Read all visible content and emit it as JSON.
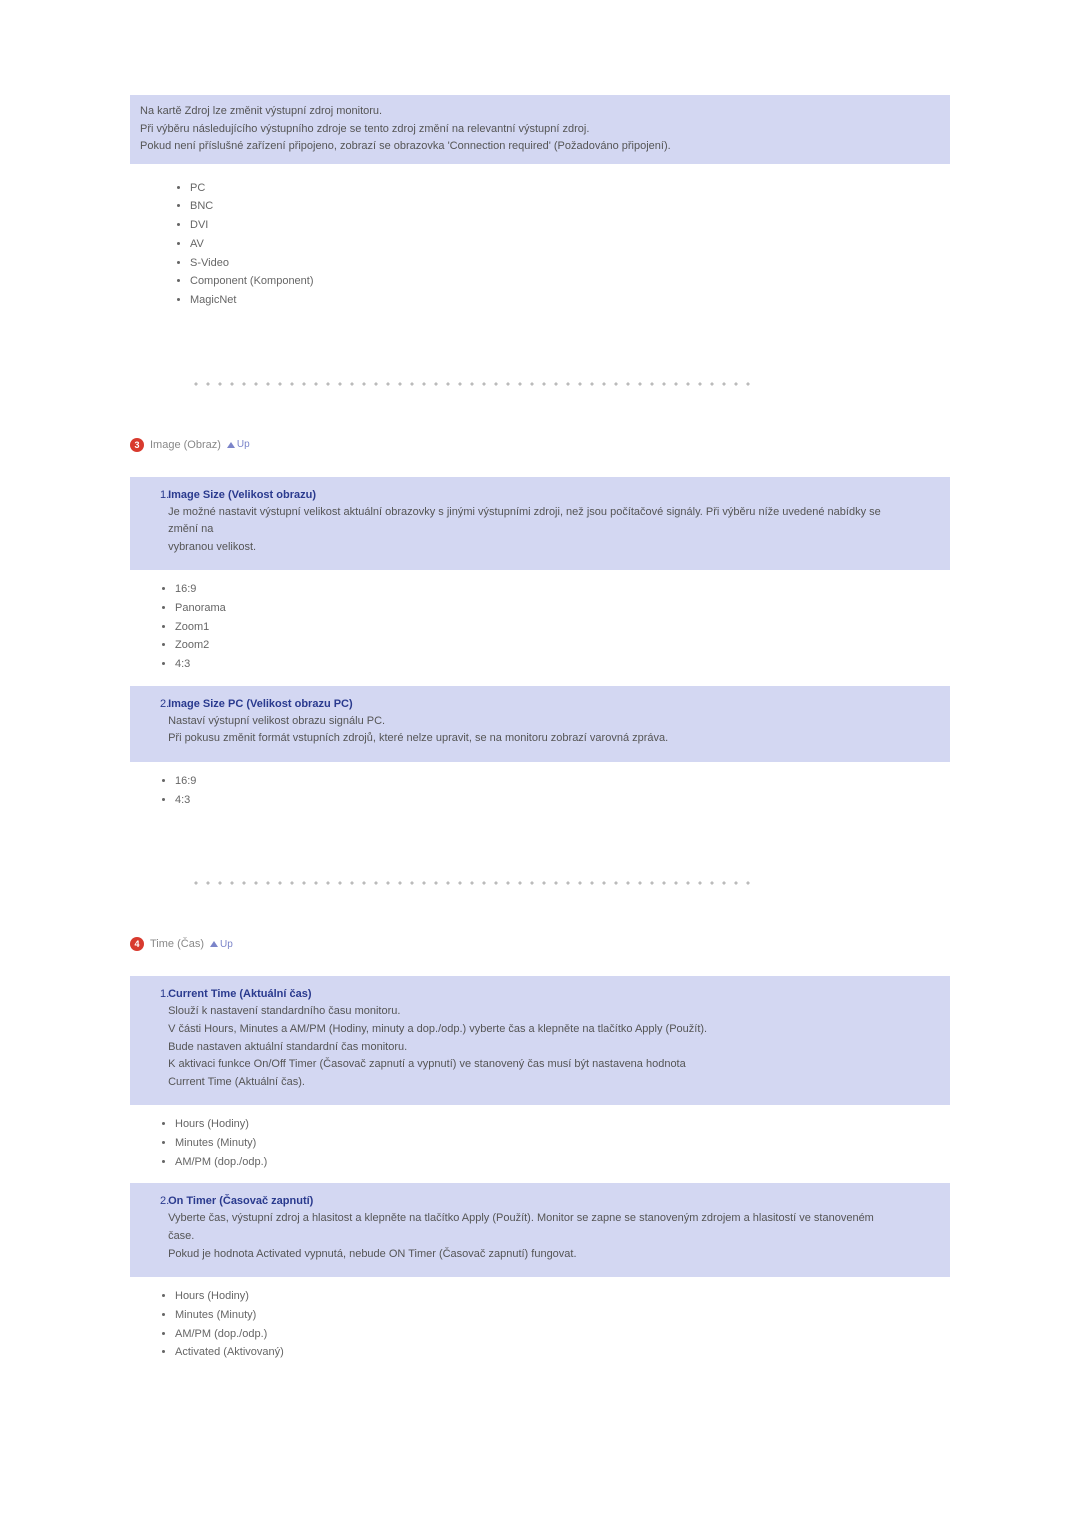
{
  "intro": {
    "line1": "Na kartě Zdroj lze změnit výstupní zdroj monitoru.",
    "line2": "Při výběru následujícího výstupního zdroje se tento zdroj změní na relevantní výstupní zdroj.",
    "line3": "Pokud není příslušné zařízení připojeno, zobrazí se obrazovka 'Connection required' (Požadováno připojení)."
  },
  "sources": [
    "PC",
    "BNC",
    "DVI",
    "AV",
    "S-Video",
    "Component (Komponent)",
    "MagicNet"
  ],
  "sec3": {
    "num": "3",
    "title": "Image (Obraz)",
    "up": "Up"
  },
  "img1": {
    "num": "1.",
    "title": "Image Size (Velikost obrazu)",
    "d1": "Je možné nastavit výstupní velikost aktuální obrazovky s jinými výstupními zdroji, než jsou počítačové signály. Při výběru níže uvedené nabídky se změní na",
    "d2": "vybranou velikost."
  },
  "img1_opts": [
    "16:9",
    "Panorama",
    "Zoom1",
    "Zoom2",
    "4:3"
  ],
  "img2": {
    "num": "2.",
    "title": "Image Size PC (Velikost obrazu PC)",
    "d1": "Nastaví výstupní velikost obrazu signálu PC.",
    "d2": "Při pokusu změnit formát vstupních zdrojů, které nelze upravit, se na monitoru zobrazí varovná zpráva."
  },
  "img2_opts": [
    "16:9",
    "4:3"
  ],
  "sec4": {
    "num": "4",
    "title": "Time (Čas)",
    "up": "Up"
  },
  "time1": {
    "num": "1.",
    "title": "Current Time (Aktuální čas)",
    "d1": "Slouží k nastavení standardního času monitoru.",
    "d2": "V části Hours, Minutes a AM/PM (Hodiny, minuty a dop./odp.) vyberte čas a klepněte na tlačítko Apply (Použít).",
    "d3": "Bude nastaven aktuální standardní čas monitoru.",
    "d4": "K aktivaci funkce On/Off Timer (Časovač zapnutí a vypnutí) ve stanovený čas musí být nastavena hodnota",
    "d5": "Current Time (Aktuální čas)."
  },
  "time1_opts": [
    "Hours (Hodiny)",
    "Minutes (Minuty)",
    "AM/PM (dop./odp.)"
  ],
  "time2": {
    "num": "2.",
    "title": "On Timer (Časovač zapnutí)",
    "d1": "Vyberte čas, výstupní zdroj a hlasitost a klepněte na tlačítko Apply (Použít). Monitor se zapne se stanoveným zdrojem a hlasitostí ve stanoveném čase.",
    "d2": "Pokud je hodnota Activated vypnutá, nebude ON Timer (Časovač zapnutí) fungovat."
  },
  "time2_opts": [
    "Hours (Hodiny)",
    "Minutes (Minuty)",
    "AM/PM (dop./odp.)",
    "Activated (Aktivovaný)"
  ]
}
